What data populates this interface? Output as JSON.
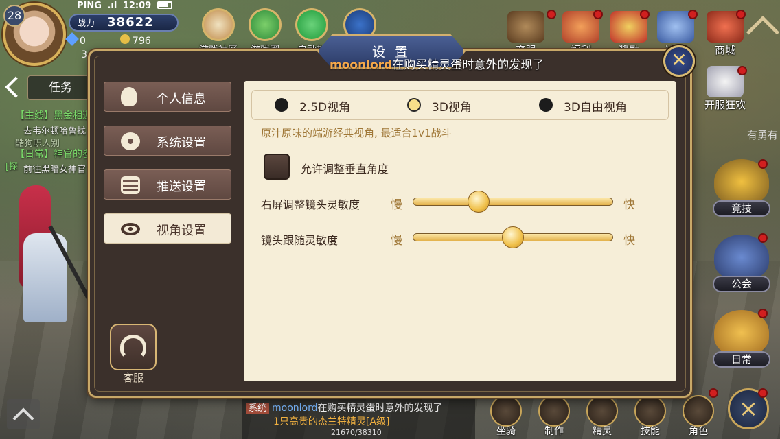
{
  "hud": {
    "level": "28",
    "ping_label": "PING",
    "clock": "12:09",
    "power_label": "战力",
    "power_value": "38622",
    "gems": "0",
    "gold": "796",
    "left_digit": "3"
  },
  "top_icons": [
    {
      "label": "游戏社区",
      "icon": "home-icon"
    },
    {
      "label": "游戏圈",
      "icon": "chat-bubble-icon"
    },
    {
      "label": "启动加",
      "icon": "wechat-icon"
    }
  ],
  "right_top": {
    "t1": "变强",
    "t2": "福利",
    "t3": "奖励",
    "t4": "冲榜",
    "shop": "商城",
    "launch_event": "开服狂欢",
    "faded_text": "有勇有"
  },
  "side_buttons": {
    "arena": "竞技",
    "guild": "公会",
    "daily": "日常"
  },
  "quest": {
    "tab": "任务",
    "main_line": "【主线】黑金相迦",
    "main_sub": "去韦尔顿哈鲁找",
    "faded": "酷狗职人别",
    "daily_line": "【日常】神官的参",
    "daily_sub": "前往黑暗女神官",
    "side_tag": "[探"
  },
  "bottom_chat": {
    "tag": "系统",
    "name": "moonlord",
    "message": "在购买精灵蛋时意外的发现了",
    "item": "1只高贵的杰兰特精灵[A级]",
    "exp": "21670/38310"
  },
  "bottom_buttons": [
    "坐骑",
    "制作",
    "精灵",
    "技能",
    "角色"
  ],
  "dialog": {
    "title": "设 置",
    "marquee_name": "moonlord",
    "marquee_text": "在购买精灵蛋时意外的发现了",
    "close_glyph": "✕",
    "menu": [
      {
        "label": "个人信息",
        "icon": "person-icon",
        "active": false
      },
      {
        "label": "系统设置",
        "icon": "gear-icon",
        "active": false
      },
      {
        "label": "推送设置",
        "icon": "message-icon",
        "active": false
      },
      {
        "label": "视角设置",
        "icon": "eye-icon",
        "active": true
      }
    ],
    "service_label": "客服",
    "view_options": [
      {
        "label": "2.5D视角",
        "selected": false
      },
      {
        "label": "3D视角",
        "selected": true
      },
      {
        "label": "3D自由视角",
        "selected": false
      }
    ],
    "hint": "原汁原味的端游经典视角, 最适合1v1战斗",
    "checkbox_label": "允许调整垂直角度",
    "checkbox_checked": false,
    "sliders": [
      {
        "label": "右屏调整镜头灵敏度",
        "slow": "慢",
        "fast": "快",
        "value": 0.33
      },
      {
        "label": "镜头跟随灵敏度",
        "slow": "慢",
        "fast": "快",
        "value": 0.5
      }
    ]
  }
}
